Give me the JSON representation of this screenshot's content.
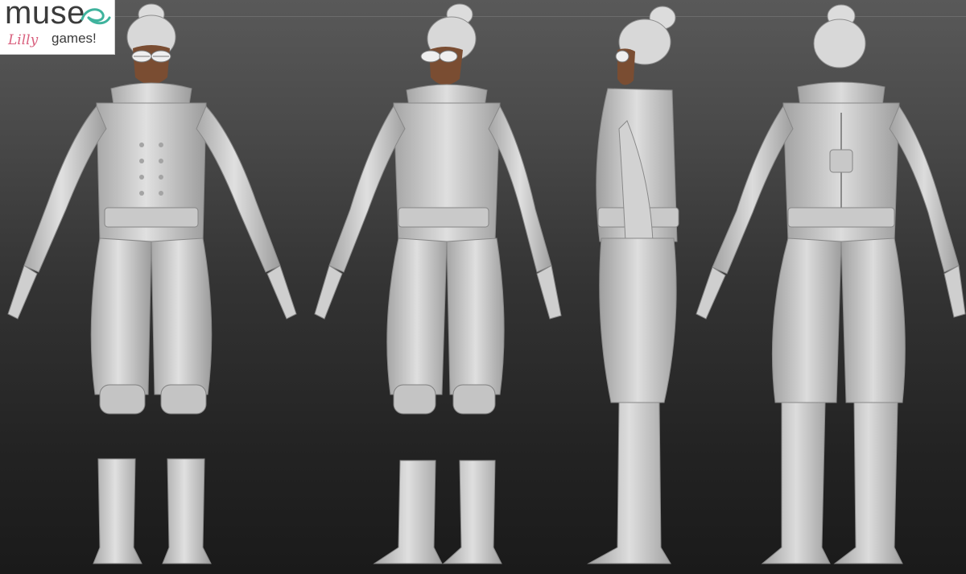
{
  "logo": {
    "brand": "muse",
    "signature": "Lilly",
    "subtitle": "games!"
  },
  "figure": {
    "views": [
      "front",
      "three-quarter",
      "side",
      "back"
    ],
    "colors": {
      "clay": "#d2d2d2",
      "clay_shadow": "#9a9a9a",
      "skin": "#7a4d32",
      "logo_accent": "#3fb39d",
      "signature": "#d9607e"
    }
  }
}
